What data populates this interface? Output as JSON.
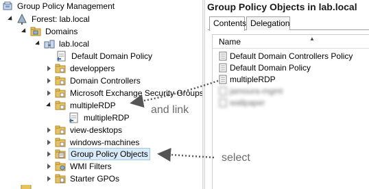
{
  "tree": {
    "items": [
      {
        "label": "Group Policy Management",
        "icon": "gpm-console-icon",
        "expander": "none"
      },
      {
        "label": "Forest: lab.local",
        "icon": "forest-icon",
        "expander": "expanded"
      },
      {
        "label": "Domains",
        "icon": "domains-folder-icon",
        "expander": "expanded"
      },
      {
        "label": "lab.local",
        "icon": "domain-icon",
        "expander": "expanded"
      },
      {
        "label": "Default Domain Policy",
        "icon": "gpo-link-icon",
        "expander": "none"
      },
      {
        "label": "developpers",
        "icon": "ou-folder-icon",
        "expander": "collapsed"
      },
      {
        "label": "Domain Controllers",
        "icon": "ou-folder-icon",
        "expander": "collapsed"
      },
      {
        "label": "Microsoft Exchange Security Groups",
        "icon": "ou-folder-icon",
        "expander": "collapsed"
      },
      {
        "label": "multipleRDP",
        "icon": "ou-folder-icon",
        "expander": "expanded"
      },
      {
        "label": "multipleRDP",
        "icon": "gpo-link-icon",
        "expander": "none"
      },
      {
        "label": "view-desktops",
        "icon": "ou-folder-icon",
        "expander": "collapsed"
      },
      {
        "label": "windows-machines",
        "icon": "ou-folder-icon",
        "expander": "collapsed"
      },
      {
        "label": "Group Policy Objects",
        "icon": "gpo-container-icon",
        "expander": "collapsed",
        "selected": true
      },
      {
        "label": "WMI Filters",
        "icon": "wmi-folder-icon",
        "expander": "collapsed"
      },
      {
        "label": "Starter GPOs",
        "icon": "starter-gpo-folder-icon",
        "expander": "collapsed"
      }
    ]
  },
  "right": {
    "title": "Group Policy Objects in lab.local",
    "tabs": [
      "Contents",
      "Delegation"
    ],
    "active_tab": "Contents",
    "column_header": "Name",
    "rows": [
      {
        "label": "Default Domain Controllers Policy",
        "blurred": false
      },
      {
        "label": "Default Domain Policy",
        "blurred": false
      },
      {
        "label": "multipleRDP",
        "blurred": false
      },
      {
        "label": "jamoura-mgmt",
        "blurred": true
      },
      {
        "label": "wallpaper",
        "blurred": true
      }
    ]
  },
  "annotations": {
    "link_note": "and link",
    "select_note": "select"
  },
  "colors": {
    "selection_bg": "#d9ebf9",
    "folder_yellow": "#e8c25a",
    "annotation_gray": "#6a6a6a"
  }
}
